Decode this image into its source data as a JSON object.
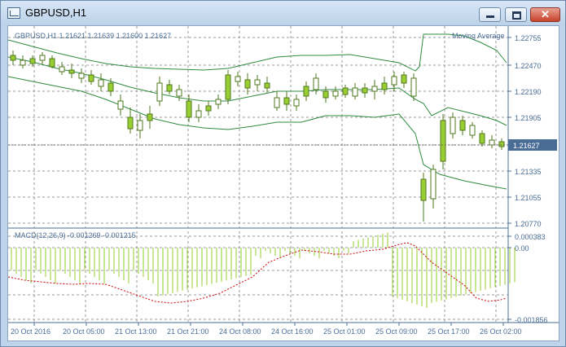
{
  "window": {
    "title": "GBPUSD,H1",
    "min_label": "—",
    "max_label": "□",
    "close_label": "✕"
  },
  "chart": {
    "info_line": "GBPUSD,H1  1.21621 1.21639 1.21600 1.21627",
    "indicator_label": "Moving Average",
    "macd_label": "MACD(12,26,9) -0.001269 -0.001215",
    "price_axis": [
      "1.22755",
      "1.22470",
      "1.22190",
      "1.21905",
      "1.21335",
      "1.21055",
      "1.20770"
    ],
    "current_price": "1.21627",
    "macd_axis": [
      "0.000383",
      "0.00",
      "-0.001856"
    ],
    "time_axis": [
      "20 Oct 2016",
      "20 Oct 05:00",
      "21 Oct 13:00",
      "21 Oct 21:00",
      "24 Oct 08:00",
      "24 Oct 16:00",
      "25 Oct 01:00",
      "25 Oct 09:00",
      "25 Oct 17:00",
      "26 Oct 02:00"
    ],
    "colors": {
      "bull_candle": "#9acd32",
      "bear_candle": "#ffffff",
      "candle_outline": "#4f7a1e",
      "envelopes": "#2e8b3f",
      "macd_hist": "#9acd32",
      "macd_signal": "#cc0000",
      "grid": "#8c8c8c",
      "axis": "#4a6d95"
    }
  }
}
